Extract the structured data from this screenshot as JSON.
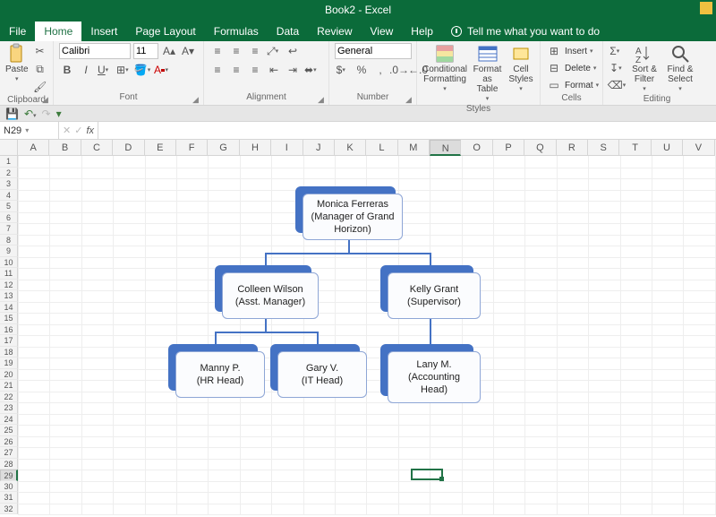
{
  "title": "Book2  -  Excel",
  "tabs": [
    "File",
    "Home",
    "Insert",
    "Page Layout",
    "Formulas",
    "Data",
    "Review",
    "View",
    "Help"
  ],
  "active_tab": "Home",
  "tellme": "Tell me what you want to do",
  "qat": {
    "save": "💾"
  },
  "namebox": "N29",
  "ribbon": {
    "clipboard": {
      "label": "Clipboard",
      "paste": "Paste"
    },
    "font": {
      "label": "Font",
      "name": "Calibri",
      "size": "11"
    },
    "alignment": {
      "label": "Alignment",
      "wrap": "Wrap Text",
      "merge": "Merge & Center"
    },
    "number": {
      "label": "Number",
      "format": "General"
    },
    "styles": {
      "label": "Styles",
      "cond": "Conditional Formatting",
      "tbl": "Format as Table",
      "cell": "Cell Styles"
    },
    "cells": {
      "label": "Cells",
      "insert": "Insert",
      "delete": "Delete",
      "format": "Format"
    },
    "editing": {
      "label": "Editing",
      "sort": "Sort & Filter",
      "find": "Find & Select"
    }
  },
  "columns": [
    "A",
    "B",
    "C",
    "D",
    "E",
    "F",
    "G",
    "H",
    "I",
    "J",
    "K",
    "L",
    "M",
    "N",
    "O",
    "P",
    "Q",
    "R",
    "S",
    "T",
    "U",
    "V"
  ],
  "row_count": 32,
  "selected_col": "N",
  "selected_row": 29,
  "chart_data": {
    "type": "org",
    "nodes": [
      {
        "id": "monica",
        "name": "Monica Ferreras",
        "role": "(Manager of Grand Horizon)",
        "parent": null
      },
      {
        "id": "colleen",
        "name": "Colleen Wilson",
        "role": "(Asst. Manager)",
        "parent": "monica"
      },
      {
        "id": "kelly",
        "name": "Kelly Grant",
        "role": "(Supervisor)",
        "parent": "monica"
      },
      {
        "id": "manny",
        "name": "Manny P.",
        "role": "(HR Head)",
        "parent": "colleen"
      },
      {
        "id": "gary",
        "name": "Gary V.",
        "role": "(IT Head)",
        "parent": "colleen"
      },
      {
        "id": "lany",
        "name": "Lany M.",
        "role": "(Accounting Head)",
        "parent": "kelly"
      }
    ]
  }
}
